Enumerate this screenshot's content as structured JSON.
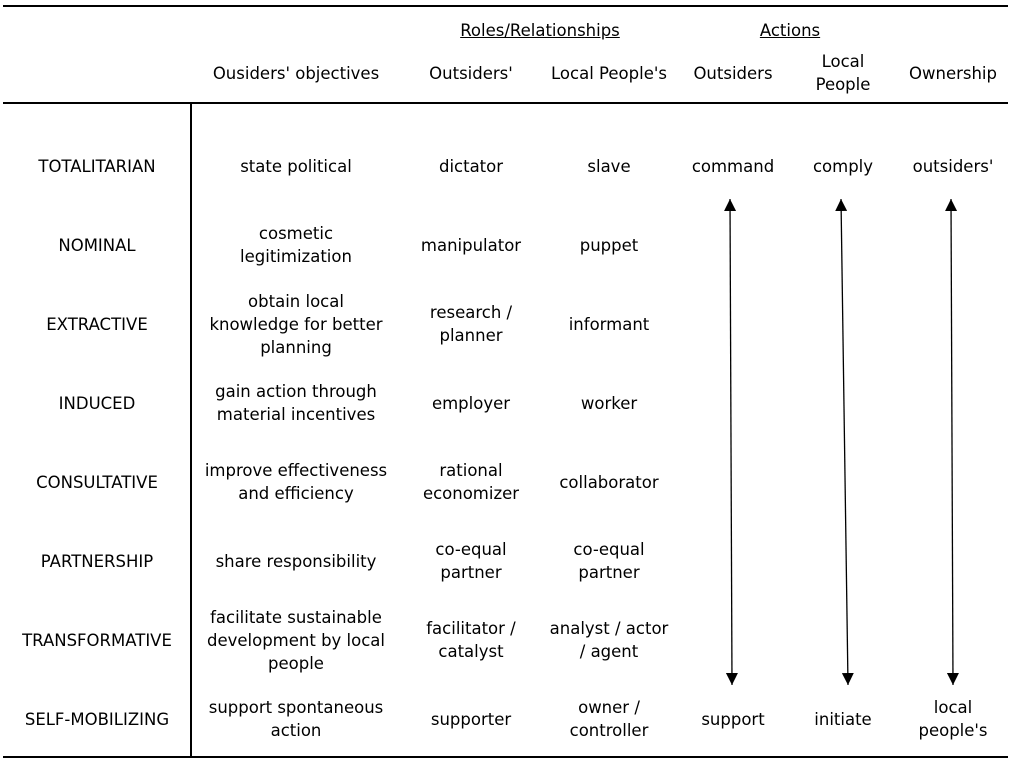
{
  "header": {
    "groups": [
      {
        "label": "Roles/Relationships"
      },
      {
        "label": "Actions"
      }
    ],
    "columns": [
      {
        "label": "Ousiders' objectives"
      },
      {
        "label": "Outsiders'"
      },
      {
        "label": "Local People's"
      },
      {
        "label": "Outsiders"
      },
      {
        "label": "Local\nPeople"
      },
      {
        "label": "Ownership"
      }
    ]
  },
  "rows": [
    {
      "type": "TOTALITARIAN",
      "objective": "state political",
      "outsider_role": "dictator",
      "local_role": "slave",
      "outsider_action": "command",
      "local_action": "comply",
      "ownership": "outsiders'"
    },
    {
      "type": "NOMINAL",
      "objective": "cosmetic\nlegitimization",
      "outsider_role": "manipulator",
      "local_role": "puppet",
      "outsider_action": "",
      "local_action": "",
      "ownership": ""
    },
    {
      "type": "EXTRACTIVE",
      "objective": "obtain local\nknowledge for better\nplanning",
      "outsider_role": "research /\nplanner",
      "local_role": "informant",
      "outsider_action": "",
      "local_action": "",
      "ownership": ""
    },
    {
      "type": "INDUCED",
      "objective": "gain action through\nmaterial incentives",
      "outsider_role": "employer",
      "local_role": "worker",
      "outsider_action": "",
      "local_action": "",
      "ownership": ""
    },
    {
      "type": "CONSULTATIVE",
      "objective": "improve effectiveness\nand efficiency",
      "outsider_role": "rational\neconomizer",
      "local_role": "collaborator",
      "outsider_action": "",
      "local_action": "",
      "ownership": ""
    },
    {
      "type": "PARTNERSHIP",
      "objective": "share responsibility",
      "outsider_role": "co-equal\npartner",
      "local_role": "co-equal\npartner",
      "outsider_action": "",
      "local_action": "",
      "ownership": ""
    },
    {
      "type": "TRANSFORMATIVE",
      "objective": "facilitate sustainable\ndevelopment by local\npeople",
      "outsider_role": "facilitator /\ncatalyst",
      "local_role": "analyst / actor\n/ agent",
      "outsider_action": "",
      "local_action": "",
      "ownership": ""
    },
    {
      "type": "SELF-MOBILIZING",
      "objective": "support spontaneous\naction",
      "outsider_role": "supporter",
      "local_role": "owner /\ncontroller",
      "outsider_action": "support",
      "local_action": "initiate",
      "ownership": "local\npeople's"
    }
  ],
  "arrows": [
    {
      "column": "Outsiders actions",
      "direction": "bidirectional",
      "from": "command",
      "to": "support"
    },
    {
      "column": "Local People actions",
      "direction": "bidirectional",
      "from": "comply",
      "to": "initiate"
    },
    {
      "column": "Ownership",
      "direction": "bidirectional",
      "from": "outsiders'",
      "to": "local people's"
    }
  ]
}
